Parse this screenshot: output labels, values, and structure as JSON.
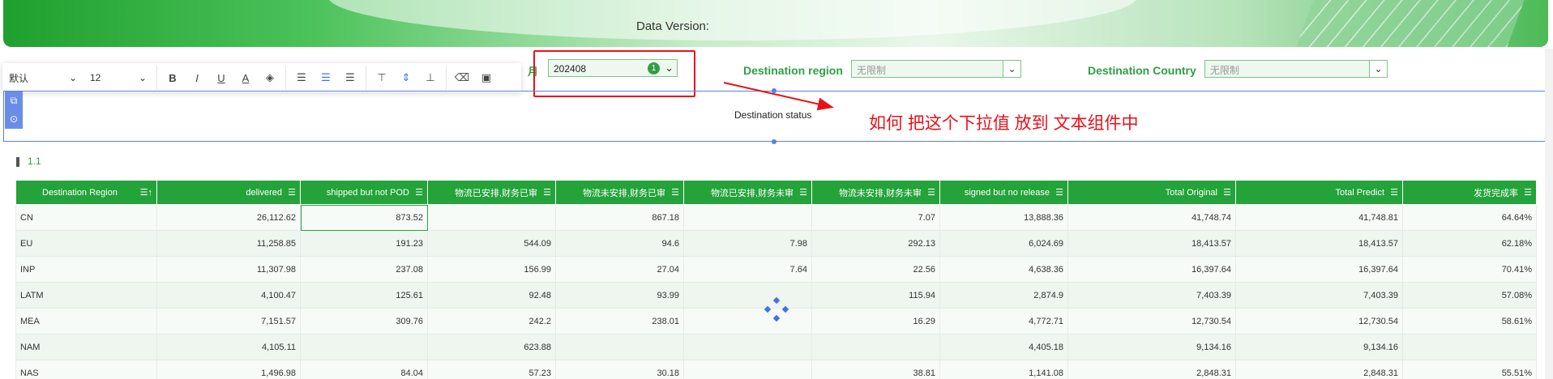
{
  "header": {
    "data_version_label": "Data Version:"
  },
  "filters": {
    "period_label_fragment": "月",
    "period_value": "202408",
    "period_badge": "1",
    "destination_region_label": "Destination region",
    "destination_region_value": "无限制",
    "destination_country_label": "Destination Country",
    "destination_country_value": "无限制"
  },
  "toolbar": {
    "font_family": "默认",
    "font_size": "12"
  },
  "text_component": {
    "content": "Destination status"
  },
  "annotation": {
    "text": "如何  把这个下拉值 放到 文本组件中"
  },
  "section": {
    "label": "1.1"
  },
  "table": {
    "columns": [
      "Destination Region",
      "delivered",
      "shipped but not POD",
      "物流已安排,财务已审",
      "物流未安排,财务已审",
      "物流已安排,财务未审",
      "物流未安排,财务未审",
      "signed but no release",
      "Total Original",
      "Total  Predict",
      "发货完成率"
    ],
    "rows": [
      [
        "CN",
        "26,112.62",
        "873.52",
        "",
        "867.18",
        "",
        "7.07",
        "13,888.36",
        "41,748.74",
        "41,748.81",
        "64.64%"
      ],
      [
        "EU",
        "11,258.85",
        "191.23",
        "544.09",
        "94.6",
        "7.98",
        "292.13",
        "6,024.69",
        "18,413.57",
        "18,413.57",
        "62.18%"
      ],
      [
        "INP",
        "11,307.98",
        "237.08",
        "156.99",
        "27.04",
        "7.64",
        "22.56",
        "4,638.36",
        "16,397.64",
        "16,397.64",
        "70.41%"
      ],
      [
        "LATM",
        "4,100.47",
        "125.61",
        "92.48",
        "93.99",
        "",
        "115.94",
        "2,874.9",
        "7,403.39",
        "7,403.39",
        "57.08%"
      ],
      [
        "MEA",
        "7,151.57",
        "309.76",
        "242.2",
        "238.01",
        "",
        "16.29",
        "4,772.71",
        "12,730.54",
        "12,730.54",
        "58.61%"
      ],
      [
        "NAM",
        "4,105.11",
        "",
        "623.88",
        "",
        "",
        "",
        "4,405.18",
        "9,134.16",
        "9,134.16",
        ""
      ],
      [
        "NAS",
        "1,496.98",
        "84.04",
        "57.23",
        "30.18",
        "",
        "38.81",
        "1,141.08",
        "2,848.31",
        "2,848.31",
        "55.51%"
      ]
    ]
  },
  "colors": {
    "brand_green": "#23a33a",
    "selection_blue": "#5b7ee5",
    "annotation_red": "#e8121b"
  }
}
